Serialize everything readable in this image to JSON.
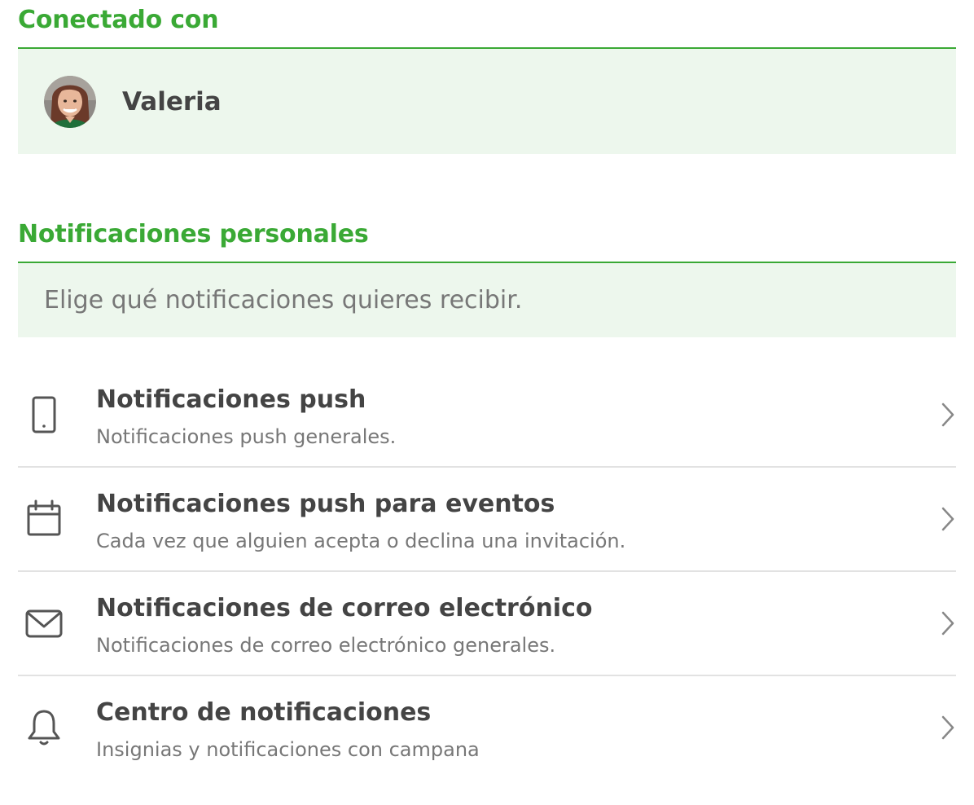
{
  "connected": {
    "title": "Conectado con",
    "user_name": "Valeria"
  },
  "personal": {
    "title": "Notificaciones personales",
    "description": "Elige qué notificaciones quieres recibir."
  },
  "items": [
    {
      "icon": "smartphone-icon",
      "title": "Notificaciones push",
      "subtitle": "Notificaciones push generales."
    },
    {
      "icon": "calendar-icon",
      "title": "Notificaciones push para eventos",
      "subtitle": "Cada vez que alguien acepta o declina una invitación."
    },
    {
      "icon": "mail-icon",
      "title": "Notificaciones de correo electrónico",
      "subtitle": "Notificaciones de correo electrónico generales."
    },
    {
      "icon": "bell-icon",
      "title": "Centro de notificaciones",
      "subtitle": "Insignias y notificaciones con campana"
    }
  ],
  "colors": {
    "accent": "#3aa935",
    "panel_bg": "#edf7ed",
    "text_primary": "#444444",
    "text_secondary": "#777777",
    "divider": "#e2e2e2"
  }
}
